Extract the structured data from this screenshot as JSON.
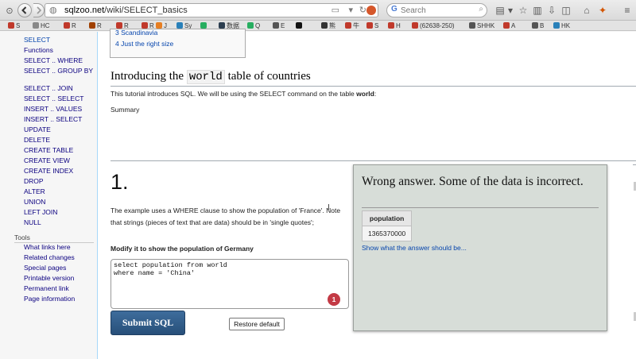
{
  "browser": {
    "url_host": "sqlzoo.net",
    "url_path": "/wiki/SELECT_basics",
    "search_placeholder": "Search",
    "search_engine_icon": "G",
    "back_icon": "back-arrow",
    "forward_icon": "forward-arrow"
  },
  "bookmarks": [
    {
      "label": "S",
      "color": "#c0392b"
    },
    {
      "label": "HC",
      "color": "#888888"
    },
    {
      "label": "R",
      "color": "#c0392b"
    },
    {
      "label": "R",
      "color": "#a04000"
    },
    {
      "label": "R",
      "color": "#c0392b"
    },
    {
      "label": "R",
      "color": "#c0392b"
    },
    {
      "label": "J",
      "color": "#e67e22"
    },
    {
      "label": "Sy",
      "color": "#2980b9"
    },
    {
      "label": "",
      "color": "#27ae60"
    },
    {
      "label": "数据",
      "color": "#2c3e50"
    },
    {
      "label": "Q",
      "color": "#27ae60"
    },
    {
      "label": "E",
      "color": "#555555"
    },
    {
      "label": "",
      "color": "#111111"
    },
    {
      "label": "熊",
      "color": "#333333"
    },
    {
      "label": "牛",
      "color": "#c0392b"
    },
    {
      "label": "S",
      "color": "#c0392b"
    },
    {
      "label": "H",
      "color": "#c0392b"
    },
    {
      "label": "(62638-250)",
      "color": "#c0392b"
    },
    {
      "label": "SHHK",
      "color": "#555555"
    },
    {
      "label": "A",
      "color": "#c0392b"
    },
    {
      "label": "B",
      "color": "#555555"
    },
    {
      "label": "HK",
      "color": "#2980b9"
    }
  ],
  "sidebar": {
    "items": [
      {
        "label": "SELECT"
      },
      {
        "label": "Functions"
      },
      {
        "label": "SELECT .. WHERE"
      },
      {
        "label": "SELECT .. GROUP BY"
      },
      {
        "label": "SELECT .. JOIN"
      },
      {
        "label": "SELECT .. SELECT"
      },
      {
        "label": "INSERT .. VALUES"
      },
      {
        "label": "INSERT .. SELECT"
      },
      {
        "label": "UPDATE"
      },
      {
        "label": "DELETE"
      },
      {
        "label": "CREATE TABLE"
      },
      {
        "label": "CREATE VIEW"
      },
      {
        "label": "CREATE INDEX"
      },
      {
        "label": "DROP"
      },
      {
        "label": "ALTER"
      },
      {
        "label": "UNION"
      },
      {
        "label": "LEFT JOIN"
      },
      {
        "label": "NULL"
      }
    ],
    "tools_heading": "Tools",
    "tools": [
      {
        "label": "What links here"
      },
      {
        "label": "Related changes"
      },
      {
        "label": "Special pages"
      },
      {
        "label": "Printable version"
      },
      {
        "label": "Permanent link"
      },
      {
        "label": "Page information"
      }
    ]
  },
  "toc": {
    "items": [
      "3 Scandinavia",
      "4 Just the right size"
    ]
  },
  "intro": {
    "heading_prefix": "Introducing the ",
    "heading_code": "world",
    "heading_suffix": " table of countries",
    "text_prefix": "This tutorial introduces SQL. We will be using the SELECT command on the table ",
    "text_bold": "world",
    "text_suffix": ":",
    "summary": "Summary"
  },
  "question": {
    "number": "1.",
    "text": "The example uses a WHERE clause to show the population of 'France'. Note that strings (pieces of text that are data) should be in 'single quotes';",
    "task": "Modify it to show the population of Germany",
    "sql": "select population from world\nwhere name = 'China'",
    "error_count": "1",
    "submit_label": "Submit SQL",
    "restore_label": "Restore default"
  },
  "result": {
    "message": "Wrong answer. Some of the data is incorrect.",
    "column": "population",
    "value": "1365370000",
    "show_answer": "Show what the answer should be..."
  }
}
